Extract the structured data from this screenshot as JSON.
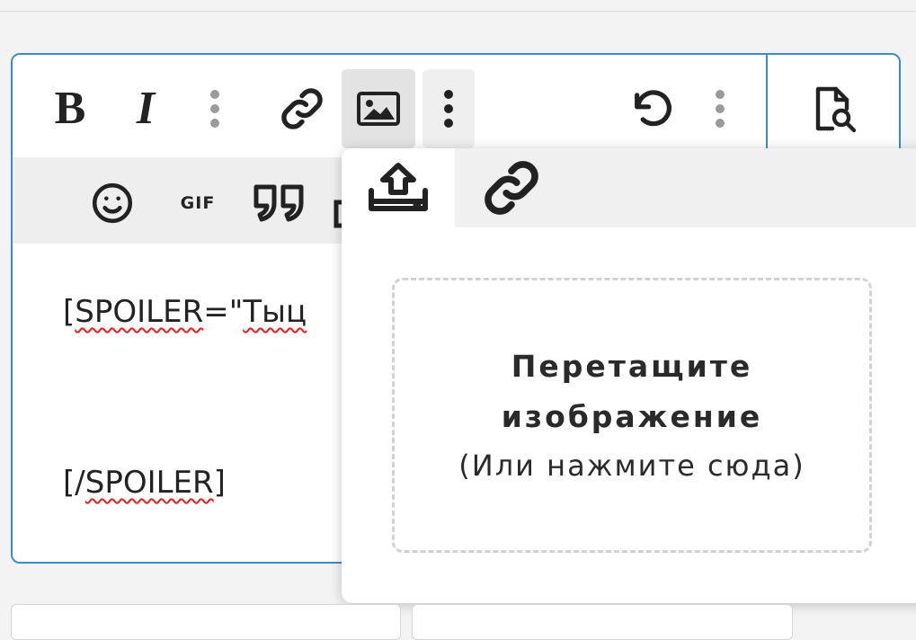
{
  "toolbar": {
    "bold_label": "B",
    "italic_label": "I",
    "buttons": [
      "bold",
      "italic",
      "more-text-options",
      "link",
      "image",
      "more-insert-options",
      "undo",
      "more-options",
      "preview"
    ]
  },
  "toolbar2": {
    "gif_label": "GIF",
    "buttons": [
      "emoji",
      "gif",
      "quote"
    ]
  },
  "content": {
    "line1_prefix": "[",
    "line1_tag": "SPOILER",
    "line1_eq": "=\"",
    "line1_word": "Тыц",
    "line2_prefix": "[/",
    "line2_tag": "SPOILER",
    "line2_suffix": "]"
  },
  "image_popup": {
    "tabs": [
      "upload",
      "link"
    ],
    "active_tab": "upload",
    "dropzone_title_line1": "Перетащите",
    "dropzone_title_line2": "изображение",
    "dropzone_hint": "(Или нажмите сюда)"
  },
  "colors": {
    "accent_border": "#3d8ac7",
    "spellcheck": "#e02020",
    "active_button_bg": "#e3e3e3"
  }
}
